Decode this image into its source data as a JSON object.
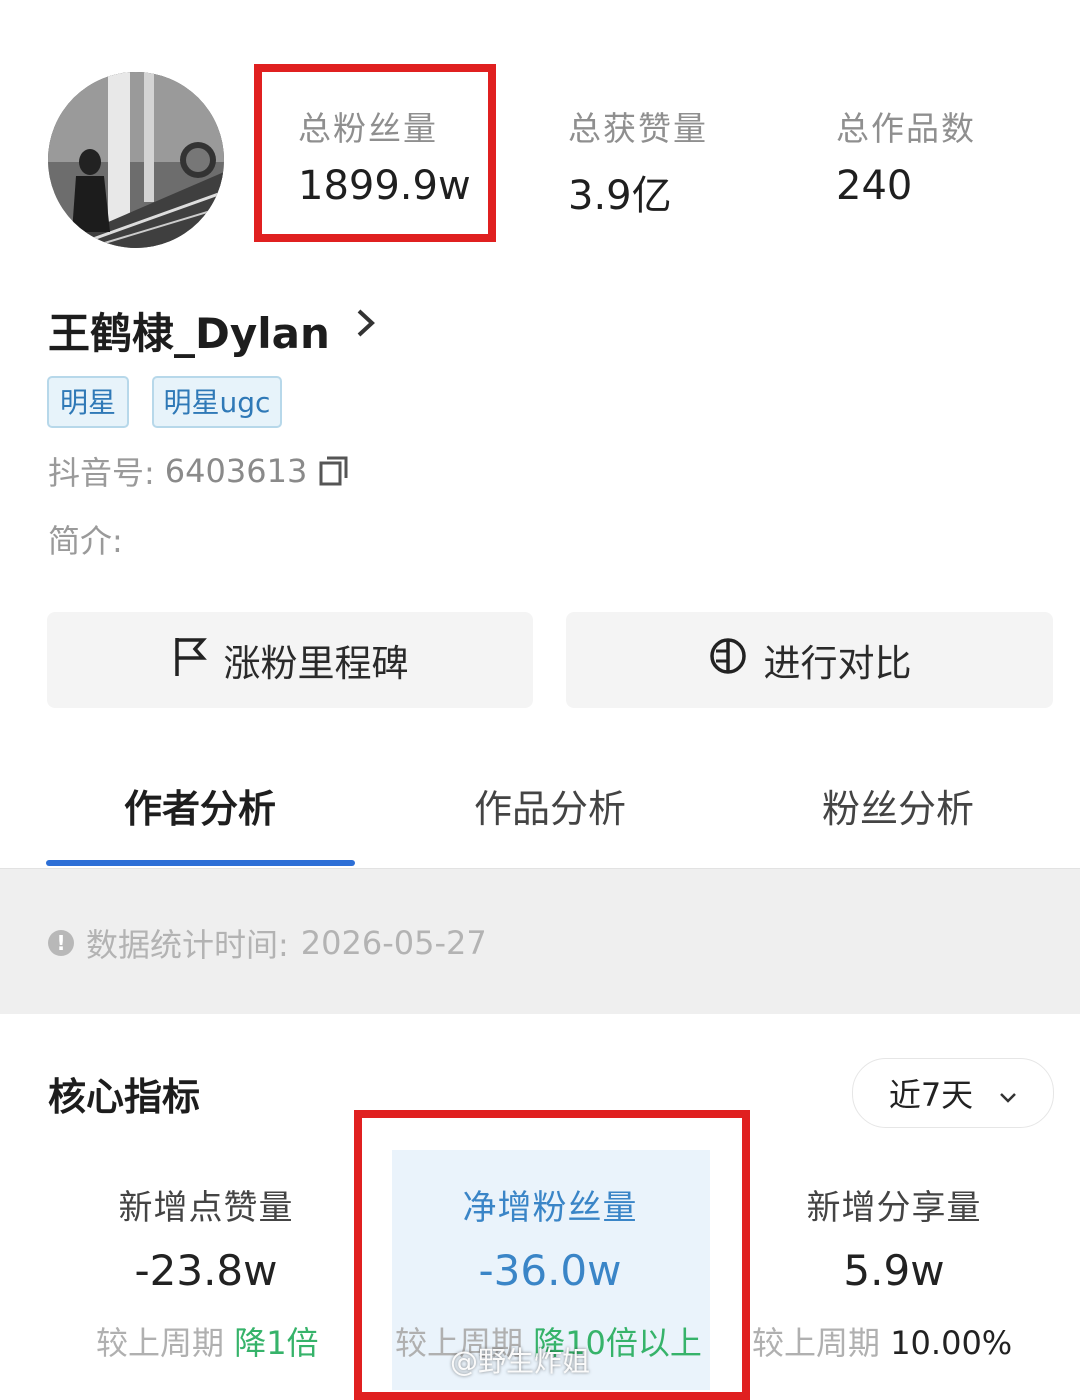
{
  "profile": {
    "name": "王鹤棣_Dylan",
    "tags": [
      "明星",
      "明星ugc"
    ],
    "douyin_id_label": "抖音号:",
    "douyin_id": "6403613",
    "intro_label": "简介:"
  },
  "stats": [
    {
      "label": "总粉丝量",
      "value": "1899.9w"
    },
    {
      "label": "总获赞量",
      "value": "3.9亿"
    },
    {
      "label": "总作品数",
      "value": "240"
    }
  ],
  "buttons": {
    "milestone": "涨粉里程碑",
    "compare": "进行对比"
  },
  "tabs": [
    "作者分析",
    "作品分析",
    "粉丝分析"
  ],
  "notice": {
    "label": "数据统计时间:",
    "date": "2026-05-27"
  },
  "core": {
    "title": "核心指标",
    "period": "近7天",
    "metrics": [
      {
        "label": "新增点赞量",
        "value": "-23.8w",
        "compare_label": "较上周期",
        "compare_value": "降1倍"
      },
      {
        "label": "净增粉丝量",
        "value": "-36.0w",
        "compare_label": "较上周期",
        "compare_value": "降10倍以上"
      },
      {
        "label": "新增分享量",
        "value": "5.9w",
        "compare_label": "较上周期",
        "compare_value": "10.00%"
      }
    ]
  },
  "watermark": "@野生炸姐",
  "colors": {
    "accent": "#2d6fd6",
    "highlight_box": "#e02020",
    "tag_text": "#2f79b7",
    "down": "#36b36a"
  }
}
